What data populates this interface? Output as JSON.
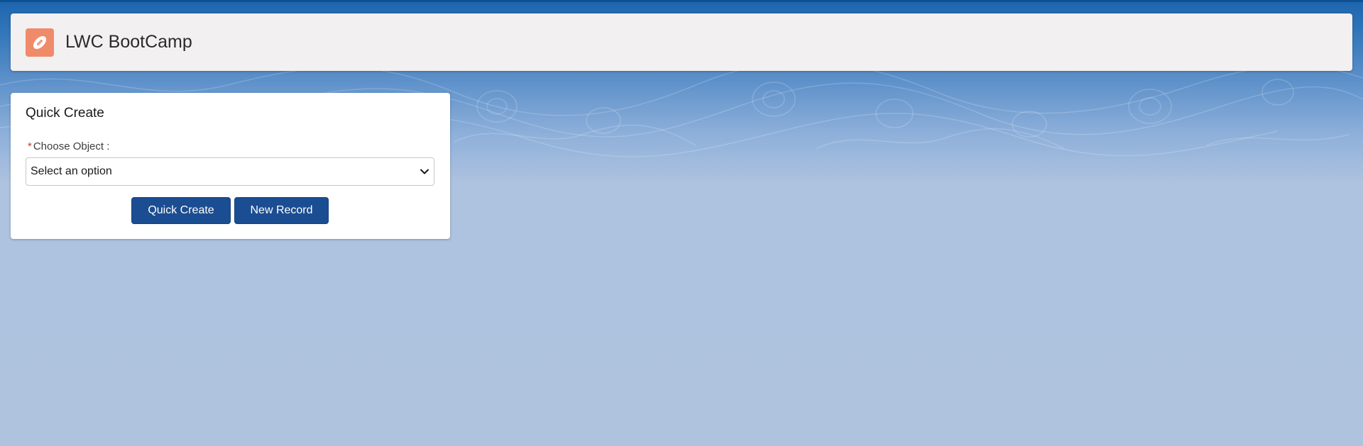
{
  "app": {
    "title": "LWC BootCamp",
    "icon": "football-icon",
    "icon_color": "#f08b6a"
  },
  "quick_create": {
    "title": "Quick Create",
    "field_label": "Choose Object :",
    "required_marker": "*",
    "select_value": "Select an option",
    "buttons": {
      "quick_create": "Quick Create",
      "new_record": "New Record"
    }
  },
  "colors": {
    "brand_button": "#1b4d92",
    "background": "#afc3df",
    "header_bg": "#f3f0f1"
  }
}
